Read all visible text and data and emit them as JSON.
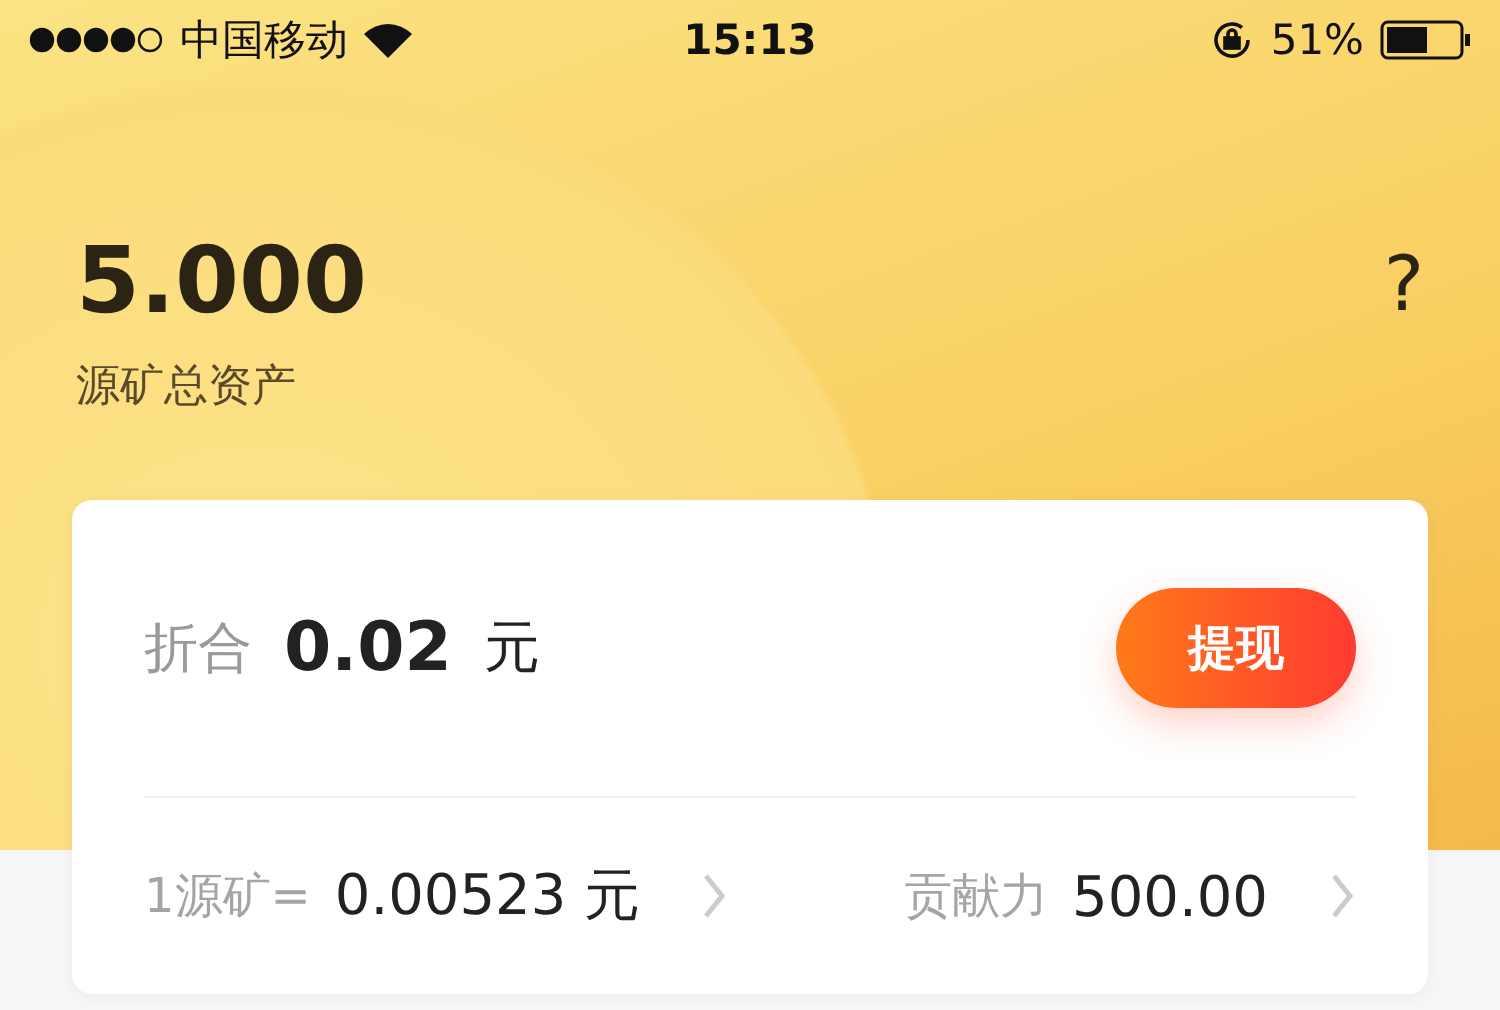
{
  "status_bar": {
    "carrier": "中国移动",
    "time": "15:13",
    "battery": "51%"
  },
  "header": {
    "amount": "5.000",
    "label": "源矿总资产",
    "help": "?"
  },
  "card": {
    "equivalent_label": "折合",
    "equivalent_value": "0.02",
    "equivalent_unit": "元",
    "withdraw_button": "提现",
    "stats": [
      {
        "label": "1源矿=",
        "value": "0.00523",
        "unit": "元"
      },
      {
        "label": "贡献力",
        "value": "500.00"
      }
    ]
  }
}
